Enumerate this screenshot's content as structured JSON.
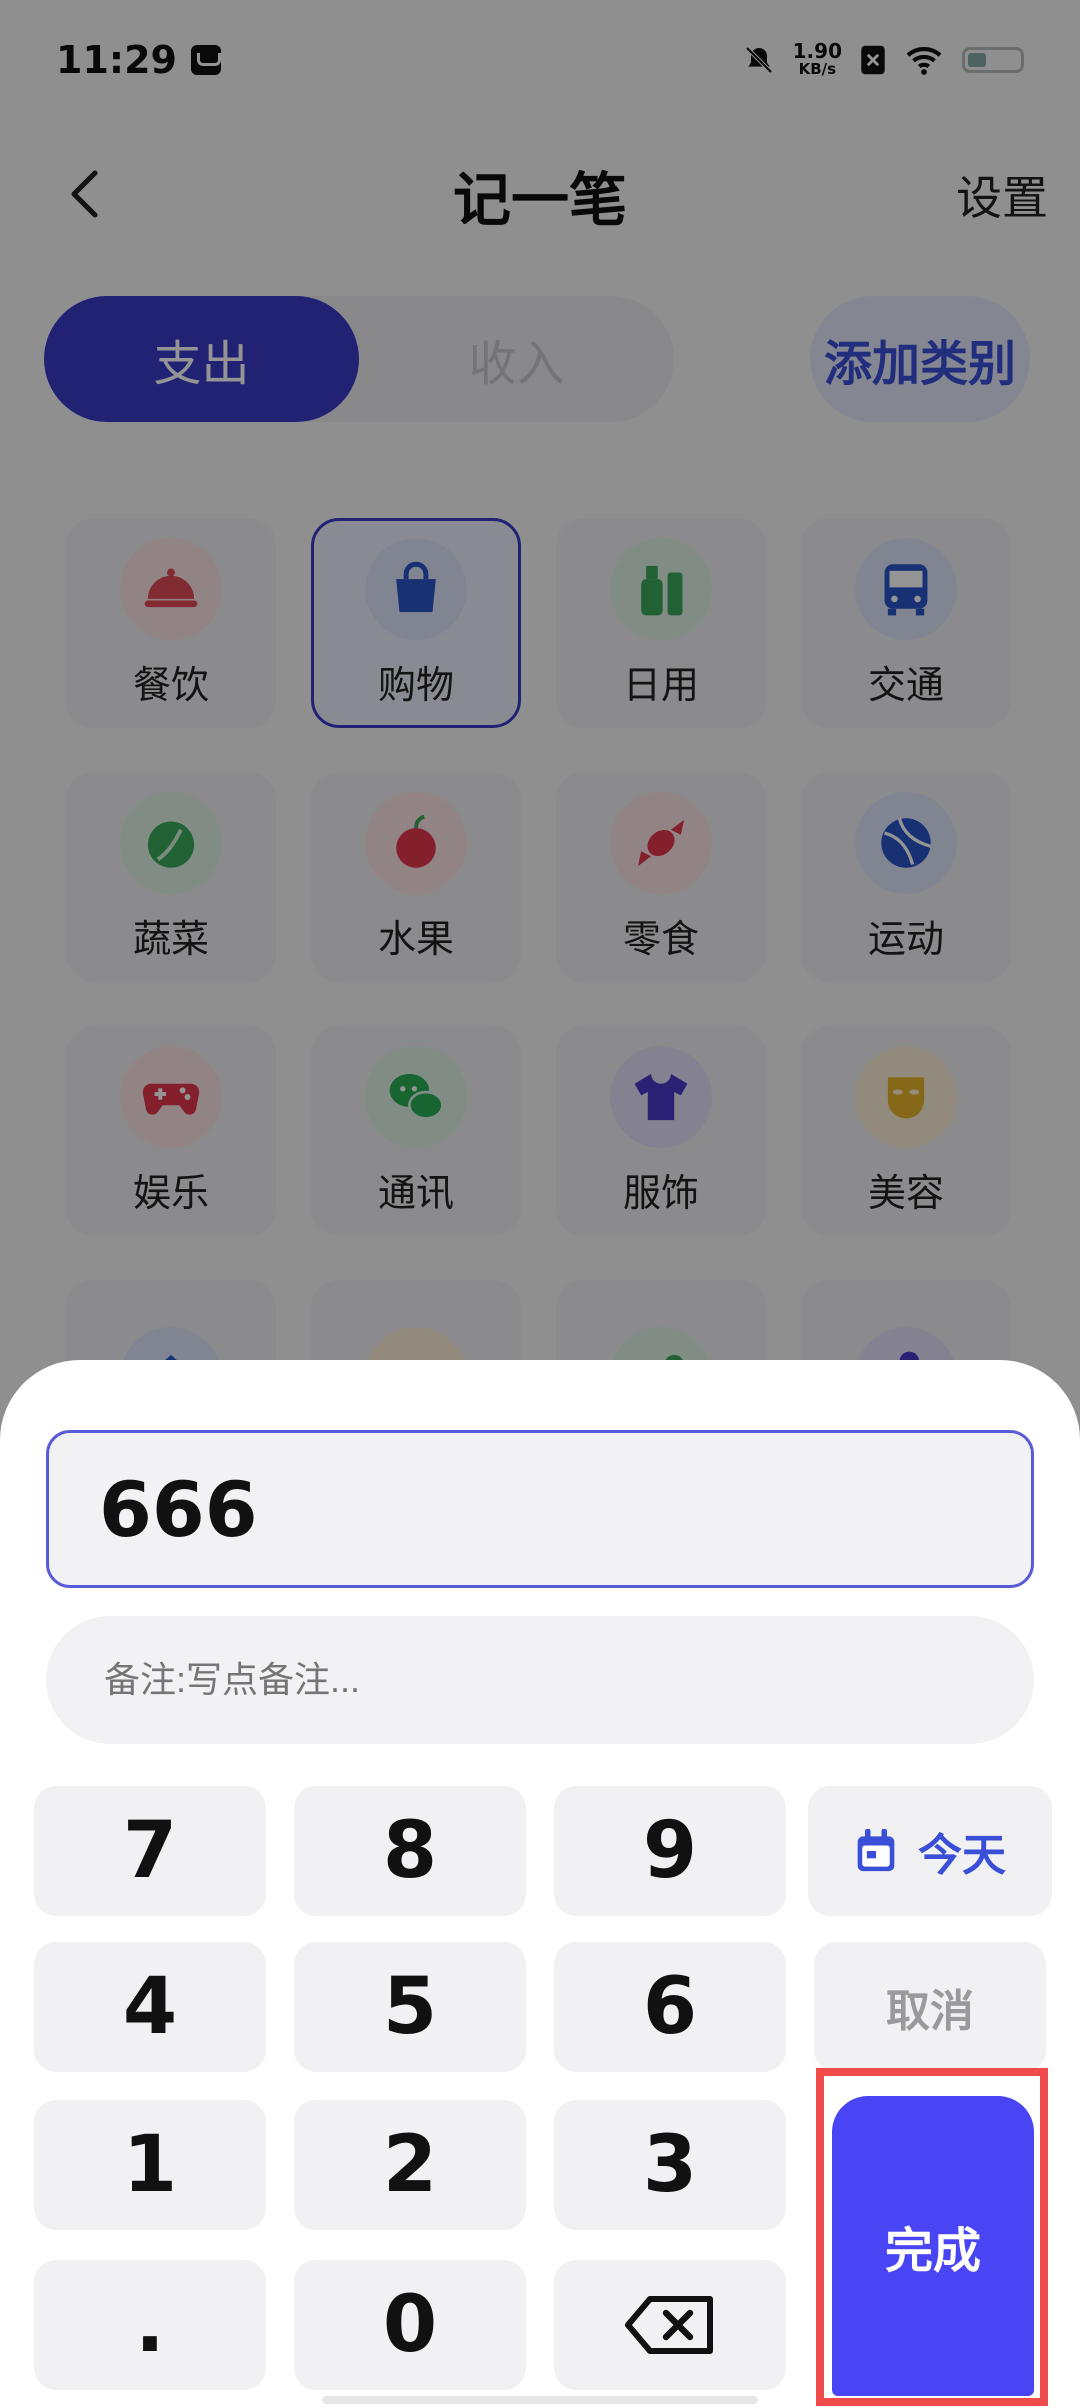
{
  "status_bar": {
    "time": "11:29",
    "net_speed_value": "1.90",
    "net_speed_unit": "KB/s"
  },
  "header": {
    "title": "记一笔",
    "settings_label": "设置"
  },
  "tabs": [
    {
      "label": "支出",
      "active": true
    },
    {
      "label": "收入",
      "active": false
    }
  ],
  "add_category_label": "添加类别",
  "categories": [
    {
      "label": "餐饮",
      "icon": "food-cloche-icon",
      "color": "#e24a56"
    },
    {
      "label": "购物",
      "icon": "shopping-bag-icon",
      "color": "#2a55c9",
      "selected": true
    },
    {
      "label": "日用",
      "icon": "daily-bottle-icon",
      "color": "#3aa85a"
    },
    {
      "label": "交通",
      "icon": "bus-icon",
      "color": "#2a55c9"
    },
    {
      "label": "蔬菜",
      "icon": "cabbage-icon",
      "color": "#3aa85a"
    },
    {
      "label": "水果",
      "icon": "apple-icon",
      "color": "#e2374c"
    },
    {
      "label": "零食",
      "icon": "candy-icon",
      "color": "#e2374c"
    },
    {
      "label": "运动",
      "icon": "ball-icon",
      "color": "#2a55c9"
    },
    {
      "label": "娱乐",
      "icon": "gamepad-icon",
      "color": "#e2374c"
    },
    {
      "label": "通讯",
      "icon": "chat-icon",
      "color": "#2aae55"
    },
    {
      "label": "服饰",
      "icon": "shirt-icon",
      "color": "#4a3ac8"
    },
    {
      "label": "美容",
      "icon": "face-mask-icon",
      "color": "#e7b32c"
    },
    {
      "label": "",
      "icon": "house-icon",
      "color": "#2a55c9"
    },
    {
      "label": "",
      "icon": "category-icon-orange",
      "color": "#e7a12c"
    },
    {
      "label": "",
      "icon": "category-icon-green",
      "color": "#3aa85a"
    },
    {
      "label": "",
      "icon": "category-icon-purple",
      "color": "#4a3ac8"
    }
  ],
  "input": {
    "amount": "666",
    "note_placeholder": "备注:写点备注..."
  },
  "keypad": {
    "keys": [
      "7",
      "8",
      "9",
      "4",
      "5",
      "6",
      "1",
      "2",
      "3",
      ".",
      "0"
    ],
    "today_label": "今天",
    "cancel_label": "取消",
    "done_label": "完成"
  },
  "colors": {
    "accent": "#3a3cc8",
    "done": "#4a45f4",
    "highlight": "#ef4b4b"
  }
}
